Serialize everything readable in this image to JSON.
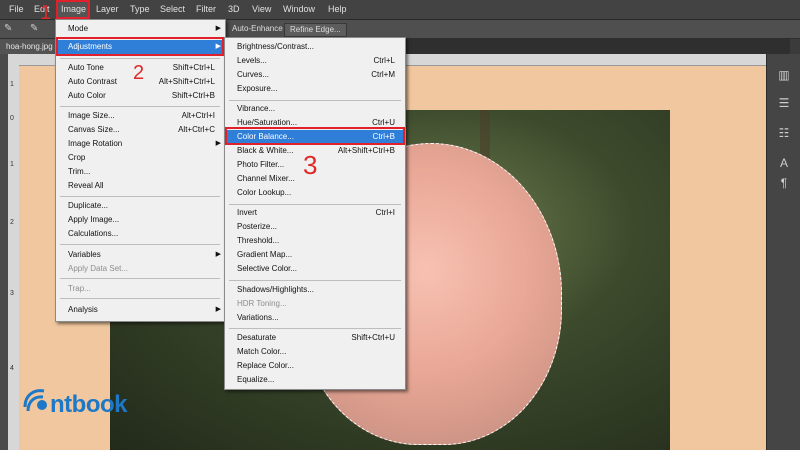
{
  "menubar": {
    "items": [
      "File",
      "Edit",
      "Image",
      "Layer",
      "Type",
      "Select",
      "Filter",
      "3D",
      "View",
      "Window",
      "Help"
    ]
  },
  "options_bar": {
    "auto_enhance": "Auto-Enhance",
    "refine_edge": "Refine Edge..."
  },
  "document_tab": {
    "label": "hoa-hong.jpg"
  },
  "rulers": {
    "left_marks": [
      "1",
      "0",
      "1",
      "2",
      "3",
      "4"
    ]
  },
  "image_menu": {
    "items": [
      {
        "label": "Mode",
        "shortcut": "",
        "submenu": true
      },
      {
        "label": "Adjustments",
        "shortcut": "",
        "submenu": true
      },
      {
        "label": "Auto Tone",
        "shortcut": "Shift+Ctrl+L"
      },
      {
        "label": "Auto Contrast",
        "shortcut": "Alt+Shift+Ctrl+L"
      },
      {
        "label": "Auto Color",
        "shortcut": "Shift+Ctrl+B"
      },
      {
        "label": "Image Size...",
        "shortcut": "Alt+Ctrl+I"
      },
      {
        "label": "Canvas Size...",
        "shortcut": "Alt+Ctrl+C"
      },
      {
        "label": "Image Rotation",
        "shortcut": "",
        "submenu": true
      },
      {
        "label": "Crop",
        "shortcut": ""
      },
      {
        "label": "Trim...",
        "shortcut": ""
      },
      {
        "label": "Reveal All",
        "shortcut": ""
      },
      {
        "label": "Duplicate...",
        "shortcut": ""
      },
      {
        "label": "Apply Image...",
        "shortcut": ""
      },
      {
        "label": "Calculations...",
        "shortcut": ""
      },
      {
        "label": "Variables",
        "shortcut": "",
        "submenu": true
      },
      {
        "label": "Apply Data Set...",
        "shortcut": "",
        "disabled": true
      },
      {
        "label": "Trap...",
        "shortcut": "",
        "disabled": true
      },
      {
        "label": "Analysis",
        "shortcut": "",
        "submenu": true
      }
    ]
  },
  "adjustments_menu": {
    "items": [
      {
        "label": "Brightness/Contrast...",
        "shortcut": ""
      },
      {
        "label": "Levels...",
        "shortcut": "Ctrl+L"
      },
      {
        "label": "Curves...",
        "shortcut": "Ctrl+M"
      },
      {
        "label": "Exposure...",
        "shortcut": ""
      },
      {
        "label": "Vibrance...",
        "shortcut": ""
      },
      {
        "label": "Hue/Saturation...",
        "shortcut": "Ctrl+U"
      },
      {
        "label": "Color Balance...",
        "shortcut": "Ctrl+B"
      },
      {
        "label": "Black & White...",
        "shortcut": "Alt+Shift+Ctrl+B"
      },
      {
        "label": "Photo Filter...",
        "shortcut": ""
      },
      {
        "label": "Channel Mixer...",
        "shortcut": ""
      },
      {
        "label": "Color Lookup...",
        "shortcut": ""
      },
      {
        "label": "Invert",
        "shortcut": "Ctrl+I"
      },
      {
        "label": "Posterize...",
        "shortcut": ""
      },
      {
        "label": "Threshold...",
        "shortcut": ""
      },
      {
        "label": "Gradient Map...",
        "shortcut": ""
      },
      {
        "label": "Selective Color...",
        "shortcut": ""
      },
      {
        "label": "Shadows/Highlights...",
        "shortcut": ""
      },
      {
        "label": "HDR Toning...",
        "shortcut": "",
        "disabled": true
      },
      {
        "label": "Variations...",
        "shortcut": ""
      },
      {
        "label": "Desaturate",
        "shortcut": "Shift+Ctrl+U"
      },
      {
        "label": "Match Color...",
        "shortcut": ""
      },
      {
        "label": "Replace Color...",
        "shortcut": ""
      },
      {
        "label": "Equalize...",
        "shortcut": ""
      }
    ]
  },
  "annotations": {
    "step1": "1",
    "step2": "2",
    "step3": "3"
  },
  "watermark": {
    "text": "ntbook"
  },
  "colors": {
    "highlight": "#2f7ed8",
    "annotation_red": "#e0202a",
    "canvas_bg": "#f1c79f",
    "logo_blue": "#1e78c8"
  }
}
